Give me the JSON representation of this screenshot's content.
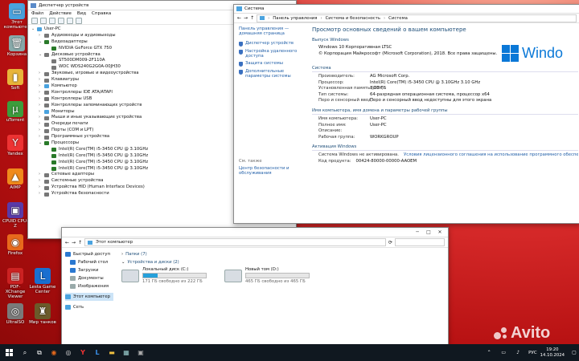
{
  "desktop": {
    "icons": [
      {
        "label": "Этот компьютер",
        "glyph": "▭",
        "color": "#4aa3df"
      },
      {
        "label": "Корзина",
        "glyph": "🗑",
        "color": "#8aa"
      },
      {
        "label": "Soft",
        "glyph": "▮",
        "color": "#e8b53a"
      },
      {
        "label": "uTorrent",
        "glyph": "µ",
        "color": "#3c9c3c"
      },
      {
        "label": "Yandex",
        "glyph": "Y",
        "color": "#e33"
      },
      {
        "label": "AIMP",
        "glyph": "▲",
        "color": "#f08a1c"
      },
      {
        "label": "CPUID CPU-Z",
        "glyph": "▣",
        "color": "#5a3aa8"
      },
      {
        "label": "Firefox",
        "glyph": "◉",
        "color": "#e86a1c"
      },
      {
        "label": "PDF-XChange Viewer",
        "glyph": "▤",
        "color": "#c22"
      },
      {
        "label": "Lesta Game Center",
        "glyph": "L",
        "color": "#1a6fd0"
      },
      {
        "label": "UltraISO",
        "glyph": "◎",
        "color": "#7a7a7a"
      },
      {
        "label": "Мир танков",
        "glyph": "♜",
        "color": "#6b5a2a"
      }
    ]
  },
  "devmgr": {
    "title": "Диспетчер устройств",
    "menu": [
      "Файл",
      "Действие",
      "Вид",
      "Справка"
    ],
    "tree": [
      {
        "label": "User-PC",
        "lvl": 0,
        "arrow": "⌄",
        "color": "#4aa3df"
      },
      {
        "label": "Аудиовходы и аудиовыходы",
        "lvl": 1,
        "arrow": "›",
        "color": "#777"
      },
      {
        "label": "Видеоадаптеры",
        "lvl": 1,
        "arrow": "⌄",
        "color": "#2a7a2a"
      },
      {
        "label": "NVIDIA GeForce GTX 750",
        "lvl": 2,
        "arrow": "",
        "color": "#2a7a2a"
      },
      {
        "label": "Дисковые устройства",
        "lvl": 1,
        "arrow": "⌄",
        "color": "#777"
      },
      {
        "label": "ST500DM009-2F110A",
        "lvl": 2,
        "arrow": "",
        "color": "#777"
      },
      {
        "label": "WDC WDS240G2G0A-00JH30",
        "lvl": 2,
        "arrow": "",
        "color": "#777"
      },
      {
        "label": "Звуковые, игровые и видеоустройства",
        "lvl": 1,
        "arrow": "›",
        "color": "#777"
      },
      {
        "label": "Клавиатуры",
        "lvl": 1,
        "arrow": "›",
        "color": "#777"
      },
      {
        "label": "Компьютер",
        "lvl": 1,
        "arrow": "›",
        "color": "#4aa3df"
      },
      {
        "label": "Контроллеры IDE ATA/ATAPI",
        "lvl": 1,
        "arrow": "›",
        "color": "#777"
      },
      {
        "label": "Контроллеры USB",
        "lvl": 1,
        "arrow": "›",
        "color": "#777"
      },
      {
        "label": "Контроллеры запоминающих устройств",
        "lvl": 1,
        "arrow": "›",
        "color": "#777"
      },
      {
        "label": "Мониторы",
        "lvl": 1,
        "arrow": "›",
        "color": "#4aa3df"
      },
      {
        "label": "Мыши и иные указывающие устройства",
        "lvl": 1,
        "arrow": "›",
        "color": "#777"
      },
      {
        "label": "Очереди печати",
        "lvl": 1,
        "arrow": "›",
        "color": "#777"
      },
      {
        "label": "Порты (COM и LPT)",
        "lvl": 1,
        "arrow": "›",
        "color": "#777"
      },
      {
        "label": "Программные устройства",
        "lvl": 1,
        "arrow": "›",
        "color": "#777"
      },
      {
        "label": "Процессоры",
        "lvl": 1,
        "arrow": "⌄",
        "color": "#2a7a2a"
      },
      {
        "label": "Intel(R) Core(TM) i5-3450 CPU @ 3.10GHz",
        "lvl": 2,
        "arrow": "",
        "color": "#2a7a2a"
      },
      {
        "label": "Intel(R) Core(TM) i5-3450 CPU @ 3.10GHz",
        "lvl": 2,
        "arrow": "",
        "color": "#2a7a2a"
      },
      {
        "label": "Intel(R) Core(TM) i5-3450 CPU @ 3.10GHz",
        "lvl": 2,
        "arrow": "",
        "color": "#2a7a2a"
      },
      {
        "label": "Intel(R) Core(TM) i5-3450 CPU @ 3.10GHz",
        "lvl": 2,
        "arrow": "",
        "color": "#2a7a2a"
      },
      {
        "label": "Сетевые адаптеры",
        "lvl": 1,
        "arrow": "›",
        "color": "#777"
      },
      {
        "label": "Системные устройства",
        "lvl": 1,
        "arrow": "›",
        "color": "#777"
      },
      {
        "label": "Устройства HID (Human Interface Devices)",
        "lvl": 1,
        "arrow": "›",
        "color": "#777"
      },
      {
        "label": "Устройства безопасности",
        "lvl": 1,
        "arrow": "›",
        "color": "#777"
      }
    ]
  },
  "system": {
    "title": "Система",
    "breadcrumb": [
      "Панель управления",
      "Система и безопасность",
      "Система"
    ],
    "left": {
      "home": "Панель управления — домашняя страница",
      "links": [
        "Диспетчер устройств",
        "Настройка удаленного доступа",
        "Защита системы",
        "Дополнительные параметры системы"
      ],
      "see_also": "См. также",
      "see_links": [
        "Центр безопасности и обслуживания"
      ]
    },
    "heading": "Просмотр основных сведений о вашем компьютере",
    "edition_header": "Выпуск Windows",
    "edition": "Windows 10 Корпоративная LTSC",
    "copyright": "© Корпорация Майкрософт (Microsoft Corporation), 2018. Все права защищены.",
    "logo_text": "Windo",
    "system_header": "Система",
    "system_rows": [
      {
        "k": "Производитель:",
        "v": "AG Microsoft Corp."
      },
      {
        "k": "Процессор:",
        "v": "Intel(R) Core(TM) i5-3450 CPU @ 3.10GHz   3.10 GHz"
      },
      {
        "k": "Установленная память (ОЗУ):",
        "v": "8,00 ГБ"
      },
      {
        "k": "Тип системы:",
        "v": "64-разрядная операционная система, процессор x64"
      },
      {
        "k": "Перо и сенсорный ввод:",
        "v": "Перо и сенсорный ввод недоступны для этого экрана"
      }
    ],
    "name_header": "Имя компьютера, имя домена и параметры рабочей группы",
    "name_rows": [
      {
        "k": "Имя компьютера:",
        "v": "User-PC"
      },
      {
        "k": "Полное имя:",
        "v": "User-PC"
      },
      {
        "k": "Описание:",
        "v": ""
      },
      {
        "k": "Рабочая группа:",
        "v": "WORKGROUP"
      }
    ],
    "activation_header": "Активация Windows",
    "activation_status": "Система Windows не активирована.",
    "activation_link": "Условия лицензионного соглашения на использование программного обеспечения корпорации",
    "product_key_label": "Код продукта:",
    "product_key": "00424-80000-00000-AAOEM"
  },
  "explorer": {
    "address": "Этот компьютер",
    "nav": [
      {
        "label": "Быстрый доступ",
        "color": "#2a78d0"
      },
      {
        "label": "Рабочий стол",
        "color": "#2a78d0"
      },
      {
        "label": "Загрузки",
        "color": "#2a78d0"
      },
      {
        "label": "Документы",
        "color": "#9aa"
      },
      {
        "label": "Изображения",
        "color": "#9aa"
      },
      {
        "label": "Этот компьютер",
        "color": "#4aa3df"
      },
      {
        "label": "Сеть",
        "color": "#4aa3df"
      }
    ],
    "folders_label": "Папки (7)",
    "drives_label": "Устройства и диски (2)",
    "drives": [
      {
        "name": "Локальный диск (C:)",
        "free": "171 ГБ свободно из 222 ГБ",
        "fill": 0.23
      },
      {
        "name": "Новый том (D:)",
        "free": "465 ГБ свободно из 465 ГБ",
        "fill": 0.0
      }
    ]
  },
  "taskbar": {
    "lang": "РУС",
    "time": "19:20",
    "date": "14.10.2024",
    "watermark": "Avito"
  }
}
